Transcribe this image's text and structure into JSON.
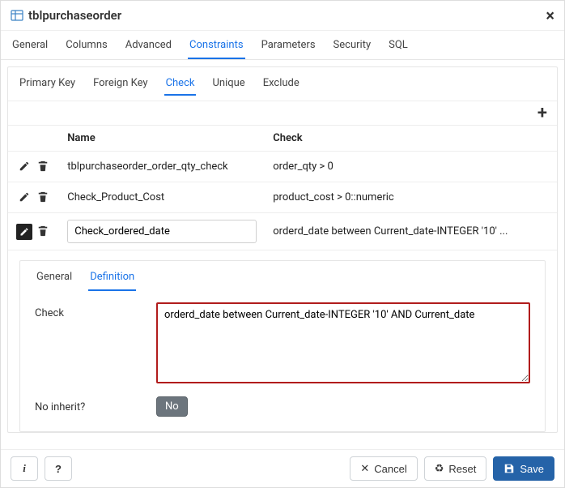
{
  "title": "tblpurchaseorder",
  "main_tabs": [
    "General",
    "Columns",
    "Advanced",
    "Constraints",
    "Parameters",
    "Security",
    "SQL"
  ],
  "main_tab_active": "Constraints",
  "constraint_subtabs": [
    "Primary Key",
    "Foreign Key",
    "Check",
    "Unique",
    "Exclude"
  ],
  "constraint_subtab_active": "Check",
  "columns": {
    "name": "Name",
    "check": "Check"
  },
  "rows": [
    {
      "name": "tblpurchaseorder_order_qty_check",
      "check": "order_qty > 0",
      "editable": false
    },
    {
      "name": "Check_Product_Cost",
      "check": "product_cost > 0::numeric",
      "editable": false
    },
    {
      "name": "Check_ordered_date",
      "check": "orderd_date between Current_date-INTEGER '10' ...",
      "editable": true
    }
  ],
  "detail_tabs": [
    "General",
    "Definition"
  ],
  "detail_tab_active": "Definition",
  "form": {
    "check_label": "Check",
    "check_value": "orderd_date between Current_date-INTEGER '10' AND Current_date",
    "no_inherit_label": "No inherit?",
    "no_inherit_value": "No"
  },
  "footer": {
    "info": "i",
    "help": "?",
    "cancel": "Cancel",
    "reset": "Reset",
    "save": "Save"
  }
}
